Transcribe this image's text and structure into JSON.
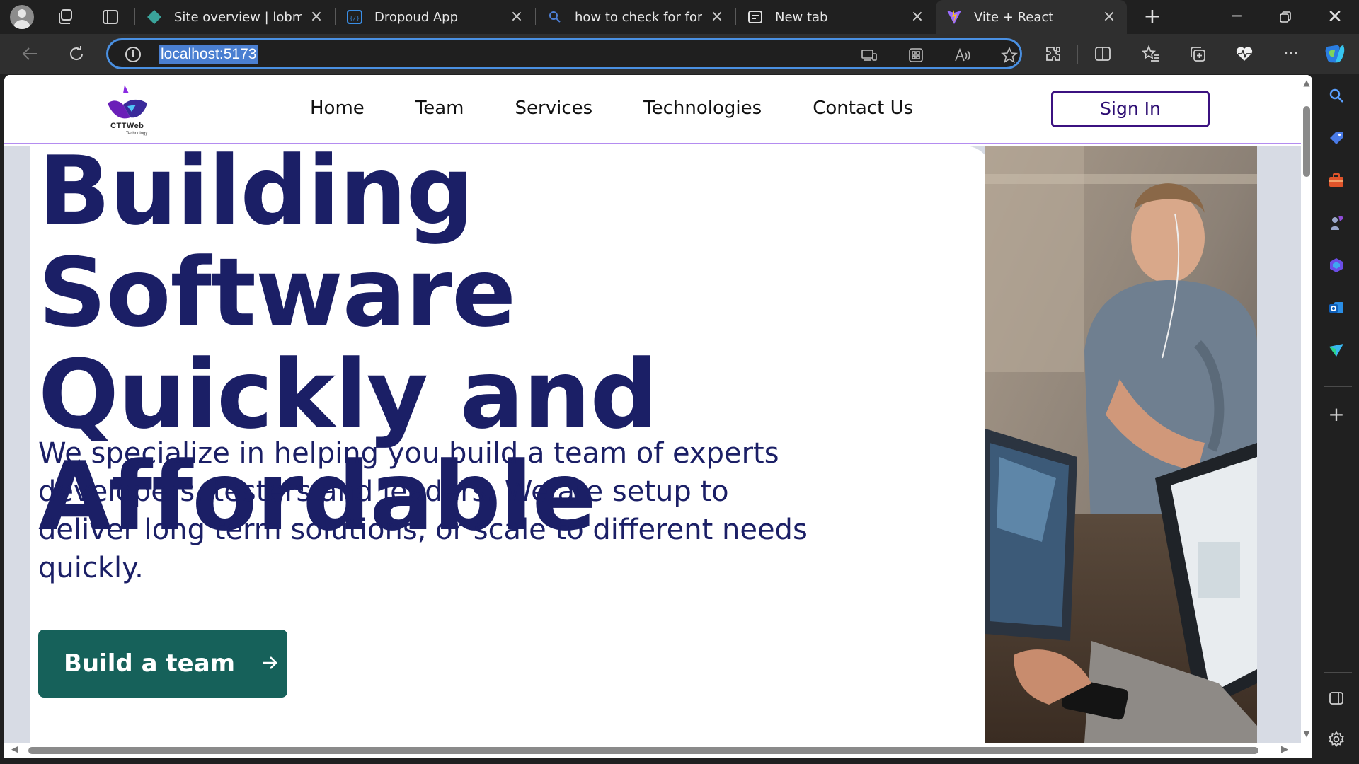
{
  "browser": {
    "tabs": [
      {
        "title": "Site overview | lobmeka",
        "active": false
      },
      {
        "title": "Dropoud App",
        "active": false
      },
      {
        "title": "how to check for forked",
        "active": false
      },
      {
        "title": "New tab",
        "active": false
      },
      {
        "title": "Vite + React",
        "active": true
      }
    ],
    "address": {
      "url": "localhost:5173"
    },
    "colors": {
      "accent": "#4a90e2",
      "chrome_bg": "#202020",
      "toolbar_bg": "#2f2f2f"
    }
  },
  "site": {
    "logo": {
      "text": "CTTWeb",
      "subtext": "Technology"
    },
    "nav": {
      "links": [
        "Home",
        "Team",
        "Services",
        "Technologies",
        "Contact Us"
      ],
      "sign_in": "Sign In"
    },
    "hero": {
      "title_lines": [
        "Building Software",
        "Quickly and",
        "Affordable"
      ],
      "description_lines": [
        "We specialize in helping you build a team of experts",
        "developers, testers and leaders. We are setup to",
        "deliver long term solutions, or scale to different needs",
        "quickly."
      ],
      "cta_label": "Build a team",
      "cta_icon": "arrow-right-icon"
    },
    "colors": {
      "primary_text": "#1b1f66",
      "cta_bg": "#16615a",
      "signin_border": "#3b1180",
      "hero_bg": "#d7dbe4"
    }
  }
}
